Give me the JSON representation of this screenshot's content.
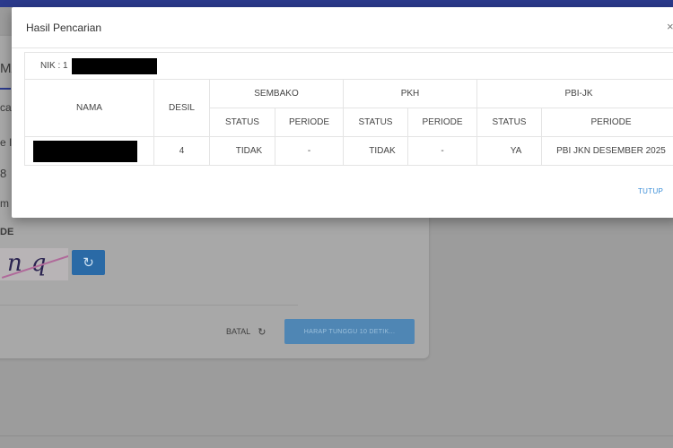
{
  "background": {
    "tab_label": "MA",
    "line_1": "ca",
    "line_2": "e I",
    "line_3": "8",
    "line_4": "m",
    "captcha_label": "DE",
    "captcha_text": "nq",
    "refresh_icon": "refresh-icon",
    "batal_label": "BATAL",
    "wait_button_label": "HARAP TUNGGU 10 DETIK..."
  },
  "modal": {
    "title": "Hasil Pencarian",
    "close_glyph": "×",
    "nik_label": "NIK : 1",
    "table": {
      "headers": {
        "nama": "NAMA",
        "desil": "DESIL",
        "sembako": "SEMBAKO",
        "pkh": "PKH",
        "pbi": "PBI-JK",
        "status": "STATUS",
        "periode": "PERIODE"
      },
      "row": {
        "desil": "4",
        "sembako_status": "TIDAK",
        "sembako_periode": "-",
        "pkh_status": "TIDAK",
        "pkh_periode": "-",
        "pbi_status": "YA",
        "pbi_periode": "PBI JKN DESEMBER 2025"
      }
    },
    "close_button_label": "TUTUP"
  },
  "colors": {
    "brand_bar": "#2b3a8c",
    "link_blue": "#3a8ed8",
    "button_blue": "#2a6aa6"
  }
}
